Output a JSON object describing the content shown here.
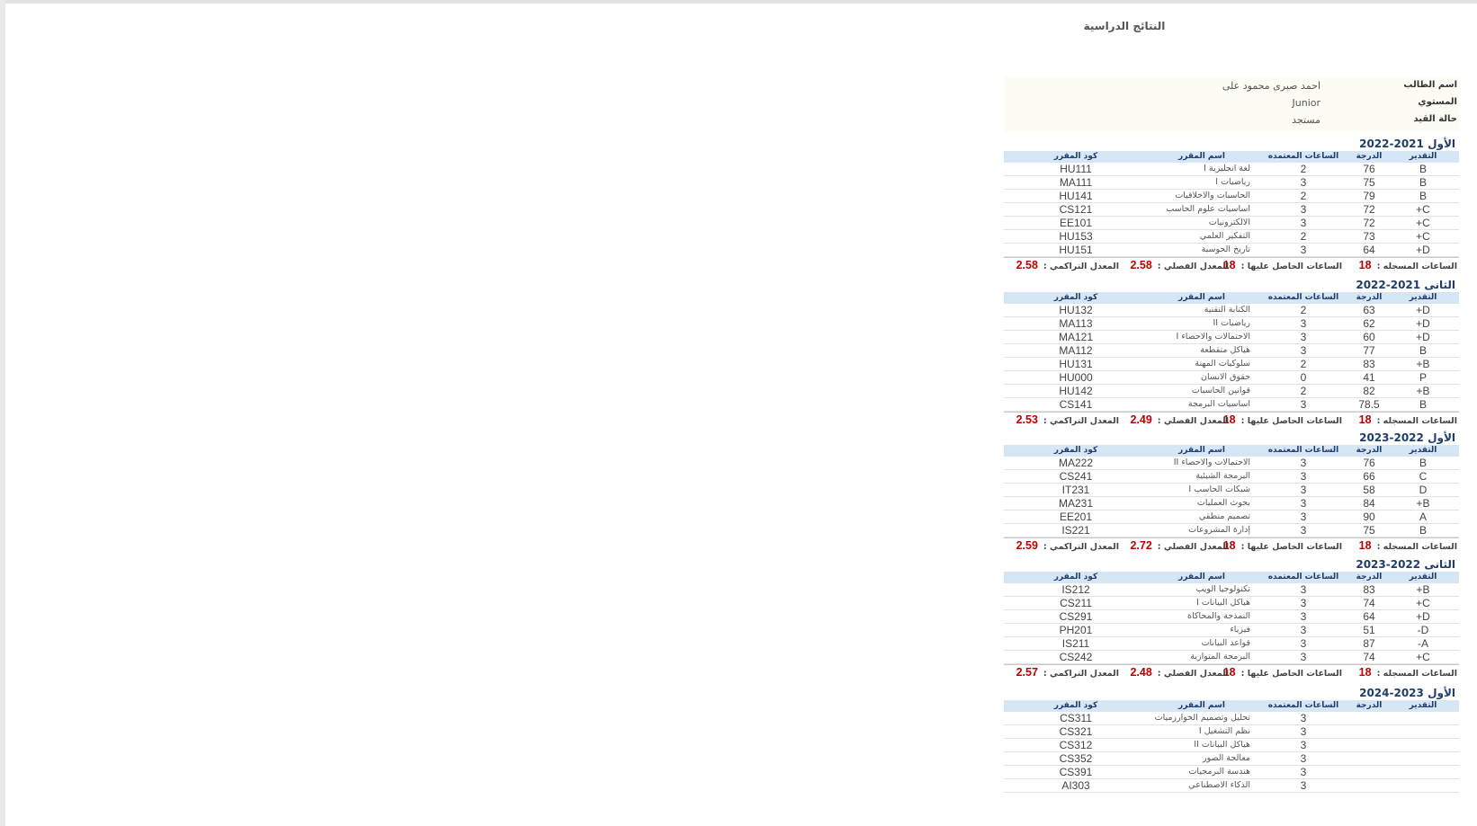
{
  "page_title": "النتائج الدراسية",
  "student": {
    "name_label": "اسم الطالب",
    "name_value": "احمد صبرى محمود على",
    "level_label": "المستوي",
    "level_value": "Junior",
    "status_label": "حالة القيد",
    "status_value": "مستجد"
  },
  "headers": {
    "grade": "التقدير",
    "degree": "الدرجة",
    "hours": "الساعات المعتمده",
    "name": "اسم المقرر",
    "code": "كود المقرر"
  },
  "summary_labels": {
    "registered": "الساعات المسجله :",
    "earned": "الساعات الحاصل عليها :",
    "term_gpa": "المعدل الفصلي :",
    "cum_gpa": "المعدل التراكمي :"
  },
  "terms": [
    {
      "title": "الأول 2021-2022",
      "courses": [
        {
          "grade": "B",
          "degree": "76",
          "hours": "2",
          "name": "لغة انجليزية I",
          "code": "HU111"
        },
        {
          "grade": "B",
          "degree": "75",
          "hours": "3",
          "name": "رياضيات I",
          "code": "MA111"
        },
        {
          "grade": "B",
          "degree": "79",
          "hours": "2",
          "name": "الحاسبات والاخلاقيات",
          "code": "HU141"
        },
        {
          "grade": "C+",
          "degree": "72",
          "hours": "3",
          "name": "اساسيات علوم الحاسب",
          "code": "CS121"
        },
        {
          "grade": "C+",
          "degree": "72",
          "hours": "3",
          "name": "الالكترونيات",
          "code": "EE101"
        },
        {
          "grade": "C+",
          "degree": "73",
          "hours": "2",
          "name": "التفكير العلمي",
          "code": "HU153"
        },
        {
          "grade": "D+",
          "degree": "64",
          "hours": "3",
          "name": "تاريخ الحوسبة",
          "code": "HU151"
        }
      ],
      "summary": {
        "registered": "18",
        "earned": "18",
        "term_gpa": "2.58",
        "cum_gpa": "2.58"
      }
    },
    {
      "title": "الثانى 2021-2022",
      "courses": [
        {
          "grade": "D+",
          "degree": "63",
          "hours": "2",
          "name": "الكتابة التقنية",
          "code": "HU132"
        },
        {
          "grade": "D+",
          "degree": "62",
          "hours": "3",
          "name": "رياضيات II",
          "code": "MA113"
        },
        {
          "grade": "D+",
          "degree": "60",
          "hours": "3",
          "name": "الاحتمالات والاحصاء I",
          "code": "MA121"
        },
        {
          "grade": "B",
          "degree": "77",
          "hours": "3",
          "name": "هياكل متقطعة",
          "code": "MA112"
        },
        {
          "grade": "B+",
          "degree": "83",
          "hours": "2",
          "name": "سلوكيات المهنة",
          "code": "HU131"
        },
        {
          "grade": "P",
          "degree": "41",
          "hours": "0",
          "name": "حقوق الانسان",
          "code": "HU000"
        },
        {
          "grade": "B+",
          "degree": "82",
          "hours": "2",
          "name": "قوانين الحاسبات",
          "code": "HU142"
        },
        {
          "grade": "B",
          "degree": "78.5",
          "hours": "3",
          "name": "اساسيات البرمجة",
          "code": "CS141"
        }
      ],
      "summary": {
        "registered": "18",
        "earned": "18",
        "term_gpa": "2.49",
        "cum_gpa": "2.53"
      }
    },
    {
      "title": "الأول 2022-2023",
      "courses": [
        {
          "grade": "B",
          "degree": "76",
          "hours": "3",
          "name": "الاحتمالات والاحصاء II",
          "code": "MA222"
        },
        {
          "grade": "C",
          "degree": "66",
          "hours": "3",
          "name": "البرمجة الشيئية",
          "code": "CS241"
        },
        {
          "grade": "D",
          "degree": "58",
          "hours": "3",
          "name": "شبكات الحاسب I",
          "code": "IT231"
        },
        {
          "grade": "B+",
          "degree": "84",
          "hours": "3",
          "name": "بحوث العمليات",
          "code": "MA231"
        },
        {
          "grade": "A",
          "degree": "90",
          "hours": "3",
          "name": "تصميم منطقي",
          "code": "EE201"
        },
        {
          "grade": "B",
          "degree": "75",
          "hours": "3",
          "name": "إدارة المشروعات",
          "code": "IS221"
        }
      ],
      "summary": {
        "registered": "18",
        "earned": "18",
        "term_gpa": "2.72",
        "cum_gpa": "2.59"
      }
    },
    {
      "title": "الثانى 2022-2023",
      "courses": [
        {
          "grade": "B+",
          "degree": "83",
          "hours": "3",
          "name": "تكنولوجيا الويب",
          "code": "IS212"
        },
        {
          "grade": "C+",
          "degree": "74",
          "hours": "3",
          "name": "هياكل البيانات I",
          "code": "CS211"
        },
        {
          "grade": "D+",
          "degree": "64",
          "hours": "3",
          "name": "النمذجة والمحاكاة",
          "code": "CS291"
        },
        {
          "grade": "D-",
          "degree": "51",
          "hours": "3",
          "name": "فيزياء",
          "code": "PH201"
        },
        {
          "grade": "A-",
          "degree": "87",
          "hours": "3",
          "name": "قواعد البيانات",
          "code": "IS211"
        },
        {
          "grade": "C+",
          "degree": "74",
          "hours": "3",
          "name": "البرمجة المتوازية",
          "code": "CS242"
        }
      ],
      "summary": {
        "registered": "18",
        "earned": "18",
        "term_gpa": "2.48",
        "cum_gpa": "2.57"
      }
    },
    {
      "title": "الأول 2023-2024",
      "courses": [
        {
          "grade": "",
          "degree": "",
          "hours": "3",
          "name": "تحليل وتصميم الخوارزميات",
          "code": "CS311"
        },
        {
          "grade": "",
          "degree": "",
          "hours": "3",
          "name": "نظم التشغيل I",
          "code": "CS321"
        },
        {
          "grade": "",
          "degree": "",
          "hours": "3",
          "name": "هياكل البيانات II",
          "code": "CS312"
        },
        {
          "grade": "",
          "degree": "",
          "hours": "3",
          "name": "معالجة الصور",
          "code": "CS352"
        },
        {
          "grade": "",
          "degree": "",
          "hours": "3",
          "name": "هندسة البرمجيات",
          "code": "CS391"
        },
        {
          "grade": "",
          "degree": "",
          "hours": "3",
          "name": "الذكاء الاصطناعي",
          "code": "AI303"
        }
      ],
      "summary": null
    }
  ]
}
